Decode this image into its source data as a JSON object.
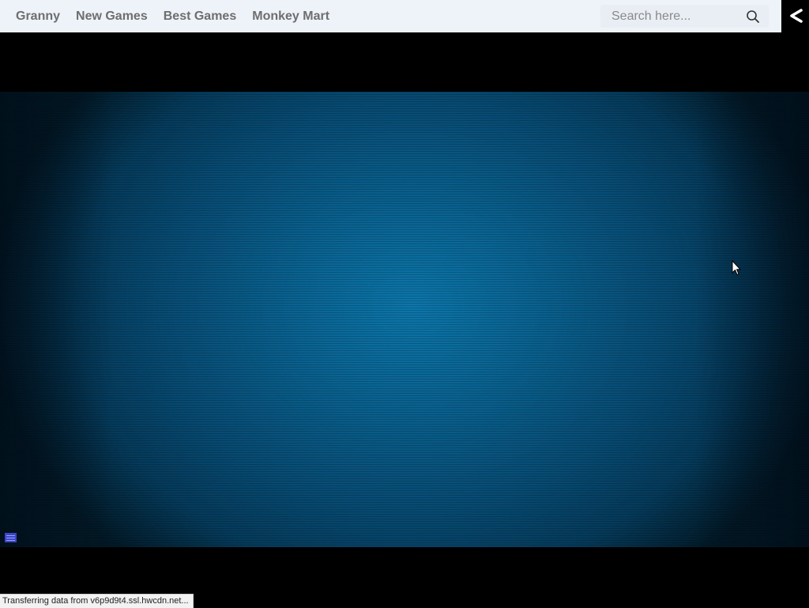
{
  "nav": {
    "items": [
      {
        "label": "Granny"
      },
      {
        "label": "New Games"
      },
      {
        "label": "Best Games"
      },
      {
        "label": "Monkey Mart"
      }
    ]
  },
  "search": {
    "placeholder": "Search here...",
    "value": "",
    "icon": "search-icon"
  },
  "share": {
    "icon": "share-icon"
  },
  "game": {
    "menu_icon": "menu-icon"
  },
  "status": {
    "text": "Transferring data from v6p9d9t4.ssl.hwcdn.net..."
  },
  "colors": {
    "topbar_bg": "#eef3fa",
    "nav_text": "#6e6e6e",
    "page_bg": "#000000",
    "game_center": "#0c76aa",
    "game_edge": "#021926"
  }
}
